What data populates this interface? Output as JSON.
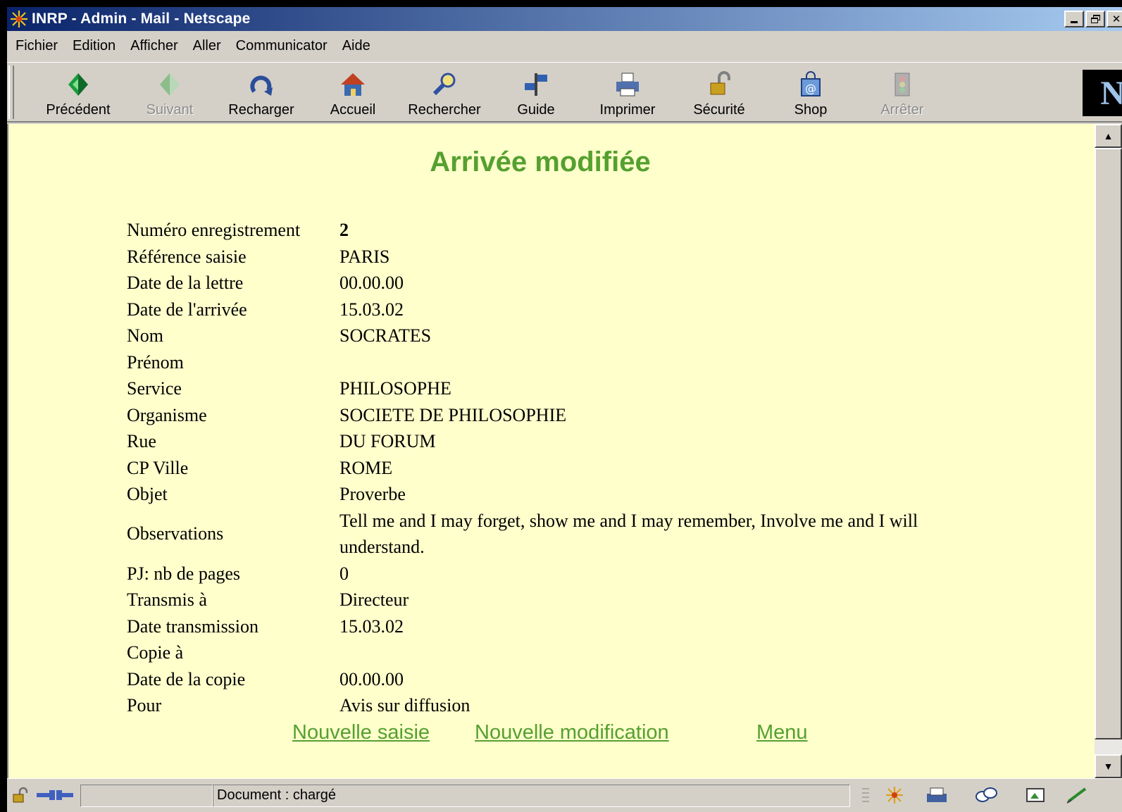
{
  "window": {
    "title": "INRP - Admin - Mail - Netscape",
    "controls": [
      "_",
      "Ő",
      "×"
    ]
  },
  "menu": [
    {
      "label": "Fichier"
    },
    {
      "label": "Edition"
    },
    {
      "label": "Afficher"
    },
    {
      "label": "Aller"
    },
    {
      "label": "Communicator"
    },
    {
      "label": "Aide"
    }
  ],
  "toolbar": {
    "buttons": [
      {
        "label": "Précédent",
        "icon": "back-arrow-icon",
        "enabled": true
      },
      {
        "label": "Suivant",
        "icon": "forward-arrow-icon",
        "enabled": false
      },
      {
        "label": "Recharger",
        "icon": "reload-icon",
        "enabled": true
      },
      {
        "label": "Accueil",
        "icon": "home-icon",
        "enabled": true
      },
      {
        "label": "Rechercher",
        "icon": "search-icon",
        "enabled": true
      },
      {
        "label": "Guide",
        "icon": "guide-icon",
        "enabled": true
      },
      {
        "label": "Imprimer",
        "icon": "printer-icon",
        "enabled": true
      },
      {
        "label": "Sécurité",
        "icon": "security-lock-icon",
        "enabled": true
      },
      {
        "label": "Shop",
        "icon": "shop-bag-icon",
        "enabled": true
      },
      {
        "label": "Arrêter",
        "icon": "stop-icon",
        "enabled": false
      }
    ],
    "logo_letter": "N"
  },
  "page": {
    "title": "Arrivée modifiée",
    "fields": [
      {
        "label": "Numéro enregistrement",
        "value": "2"
      },
      {
        "label": "Référence saisie",
        "value": "PARIS"
      },
      {
        "label": "Date de la lettre",
        "value": "00.00.00"
      },
      {
        "label": "Date de l'arrivée",
        "value": "15.03.02"
      },
      {
        "label": "Nom",
        "value": "SOCRATES"
      },
      {
        "label": "Prénom",
        "value": ""
      },
      {
        "label": "Service",
        "value": "PHILOSOPHE"
      },
      {
        "label": "Organisme",
        "value": "SOCIETE DE PHILOSOPHIE"
      },
      {
        "label": "Rue",
        "value": "DU FORUM"
      },
      {
        "label": "CP Ville",
        "value": "ROME"
      },
      {
        "label": "Objet",
        "value": "Proverbe"
      },
      {
        "label": "Observations",
        "value": "Tell me and I may forget, show me and I may remember, Involve me and I will understand."
      },
      {
        "label": "PJ: nb de pages",
        "value": "0"
      },
      {
        "label": "Transmis à",
        "value": "Directeur"
      },
      {
        "label": "Date transmission",
        "value": "15.03.02"
      },
      {
        "label": "Copie à",
        "value": ""
      },
      {
        "label": "Date de la copie",
        "value": "00.00.00"
      },
      {
        "label": "Pour",
        "value": "Avis sur diffusion"
      }
    ],
    "links": {
      "new_entry": "Nouvelle saisie",
      "new_modification": "Nouvelle modification",
      "menu": "Menu"
    },
    "colors": {
      "background": "#ffffcc",
      "accent_green": "#55a030"
    }
  },
  "status": {
    "text": "Document : chargé"
  }
}
